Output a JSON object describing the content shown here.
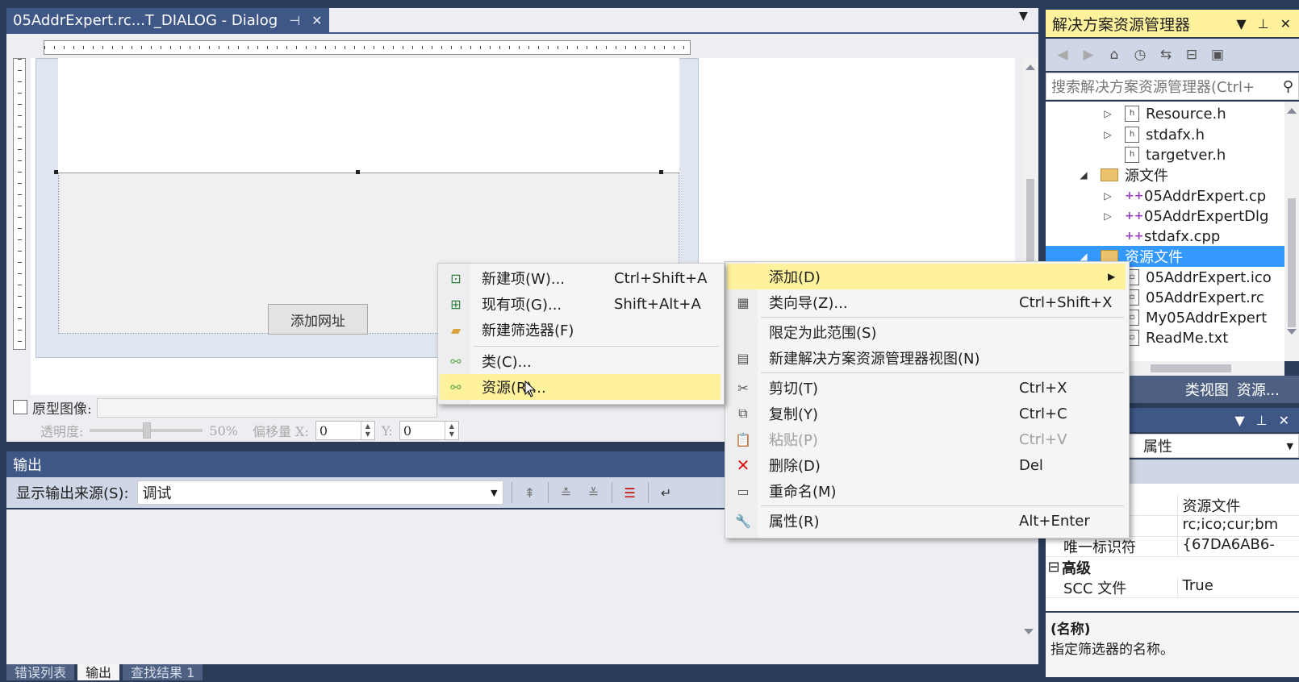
{
  "doc": {
    "tab_title": "05AddrExpert.rc...T_DIALOG - Dialog",
    "add_url_button": "添加网址",
    "proto_label": "原型图像:",
    "opacity_label": "透明度:",
    "opacity_value": "50%",
    "offset_x_label": "偏移量 X:",
    "offset_x_value": "0",
    "offset_y_label": "Y:",
    "offset_y_value": "0"
  },
  "output": {
    "title": "输出",
    "source_label": "显示输出来源(S):",
    "source_value": "调试",
    "bottom_tabs": [
      "错误列表",
      "输出",
      "查找结果 1"
    ]
  },
  "solution_explorer": {
    "title": "解决方案资源管理器",
    "search_placeholder": "搜索解决方案资源管理器(Ctrl+",
    "tree": [
      {
        "label": "Resource.h",
        "kind": "h"
      },
      {
        "label": "stdafx.h",
        "kind": "h"
      },
      {
        "label": "targetver.h",
        "kind": "h"
      },
      {
        "label": "源文件",
        "kind": "folder"
      },
      {
        "label": "05AddrExpert.cp",
        "kind": "cpp"
      },
      {
        "label": "05AddrExpertDlg",
        "kind": "cpp"
      },
      {
        "label": "stdafx.cpp",
        "kind": "cpp"
      },
      {
        "label": "资源文件",
        "kind": "folder",
        "selected": true
      },
      {
        "label": "05AddrExpert.ico",
        "kind": "file"
      },
      {
        "label": "05AddrExpert.rc",
        "kind": "file"
      },
      {
        "label": "My05AddrExpert",
        "kind": "file"
      },
      {
        "label": "ReadMe.txt",
        "kind": "file"
      }
    ],
    "bottom_tabs": [
      "类视图",
      "资源..."
    ]
  },
  "properties": {
    "selected_object": "属性",
    "rows": [
      {
        "key": "",
        "value": "资源文件"
      },
      {
        "key": "",
        "value": "rc;ico;cur;bm"
      },
      {
        "key": "唯一标识符",
        "value": "{67DA6AB6-"
      }
    ],
    "category": "高级",
    "scc_key": "SCC 文件",
    "scc_value": "True",
    "desc_title": "(名称)",
    "desc_text": "指定筛选器的名称。"
  },
  "menu_add": {
    "items": [
      {
        "label": "新建项(W)...",
        "shortcut": "Ctrl+Shift+A",
        "icon": "new-item-icon"
      },
      {
        "label": "现有项(G)...",
        "shortcut": "Shift+Alt+A",
        "icon": "existing-item-icon"
      },
      {
        "label": "新建筛选器(F)",
        "shortcut": "",
        "icon": "new-filter-icon"
      },
      {
        "label": "类(C)...",
        "shortcut": "",
        "icon": "class-icon"
      },
      {
        "label": "资源(R)...",
        "shortcut": "",
        "icon": "resource-icon",
        "highlighted": true
      }
    ]
  },
  "menu_main": {
    "items": [
      {
        "label": "添加(D)",
        "shortcut": "",
        "highlighted": true,
        "submenu": true
      },
      {
        "label": "类向导(Z)...",
        "shortcut": "Ctrl+Shift+X",
        "icon": "class-wizard-icon"
      },
      {
        "label": "限定为此范围(S)",
        "shortcut": ""
      },
      {
        "label": "新建解决方案资源管理器视图(N)",
        "shortcut": "",
        "icon": "new-view-icon"
      },
      {
        "label": "剪切(T)",
        "shortcut": "Ctrl+X",
        "icon": "scissors-icon"
      },
      {
        "label": "复制(Y)",
        "shortcut": "Ctrl+C",
        "icon": "copy-icon"
      },
      {
        "label": "粘贴(P)",
        "shortcut": "Ctrl+V",
        "icon": "paste-icon",
        "disabled": true
      },
      {
        "label": "删除(D)",
        "shortcut": "Del",
        "icon": "delete-icon"
      },
      {
        "label": "重命名(M)",
        "shortcut": "",
        "icon": "rename-icon"
      },
      {
        "label": "属性(R)",
        "shortcut": "Alt+Enter",
        "icon": "wrench-icon"
      }
    ]
  },
  "colors": {
    "chrome": "#2b3c59",
    "tab_active": "#3f5787",
    "highlight": "#fff29d",
    "selection": "#3399ff"
  }
}
